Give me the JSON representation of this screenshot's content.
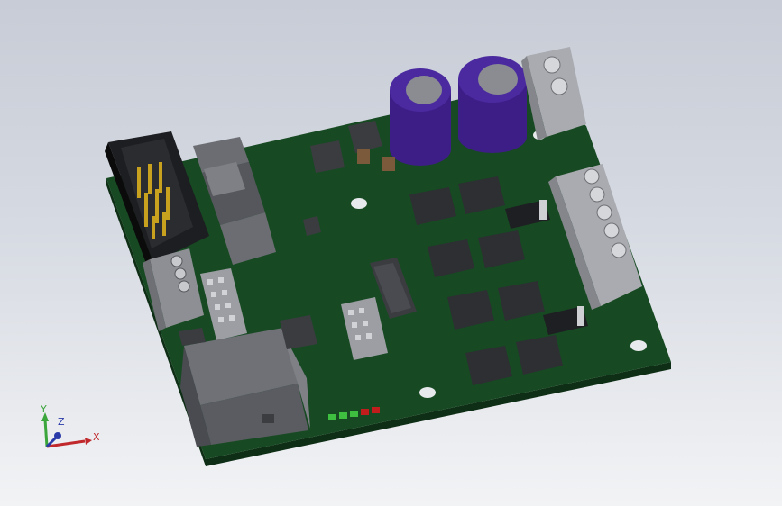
{
  "axes": {
    "x_label": "X",
    "y_label": "Y",
    "z_label": "Z",
    "x_color": "#c0282b",
    "y_color": "#3aa53a",
    "z_color": "#2a3aa8"
  },
  "colors": {
    "pcb": "#174a22",
    "pcb_edge": "#0e2e15",
    "capacitor": "#3d1e86",
    "terminal_block": "#a9abb0",
    "ic": "#2d2f33",
    "header": "#1d1e21",
    "pins": "#c8a21e",
    "led_green": "#3fbf3f",
    "led_red": "#c21d1d"
  }
}
